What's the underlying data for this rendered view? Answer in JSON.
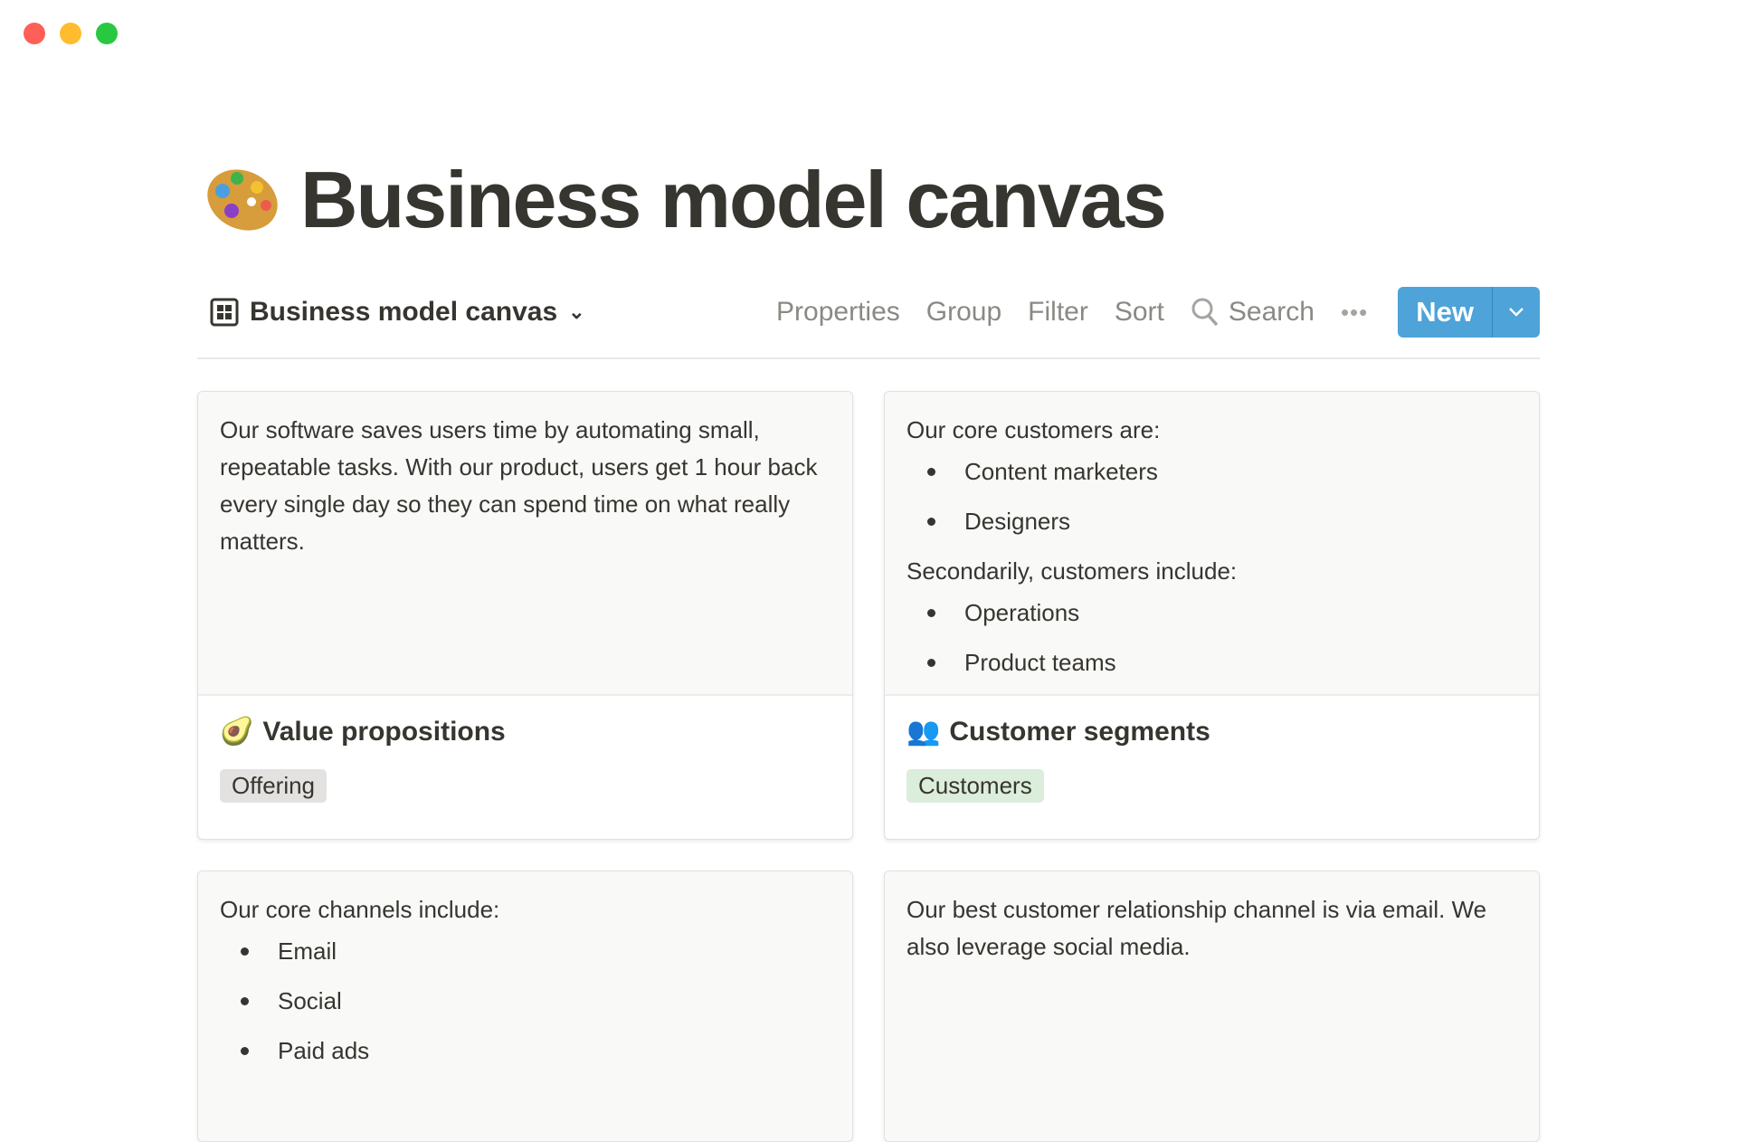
{
  "window": {
    "controls": [
      {
        "name": "close",
        "color": "#fe5f57"
      },
      {
        "name": "minimize",
        "color": "#febc2e"
      },
      {
        "name": "maximize",
        "color": "#28c840"
      }
    ]
  },
  "page": {
    "icon": "artist-palette-icon",
    "title": "Business model canvas"
  },
  "toolbar": {
    "view_name": "Business model canvas",
    "properties": "Properties",
    "group": "Group",
    "filter": "Filter",
    "sort": "Sort",
    "search": "Search",
    "new": "New",
    "accent": "#4ea3d8"
  },
  "cards": [
    {
      "paragraphs": [
        "Our software saves users time by automating small, repeatable tasks. With our product, users get 1 hour back every single day so they can spend time on what really matters."
      ],
      "icon": "avocado-icon",
      "title": "Value propositions",
      "tag": "Offering",
      "tag_color": "#e3e2e0"
    },
    {
      "intro": "Our core customers are:",
      "list1": [
        "Content marketers",
        "Designers"
      ],
      "mid": "Secondarily, customers include:",
      "list2": [
        "Operations",
        "Product teams"
      ],
      "icon": "busts-icon",
      "title": "Customer segments",
      "tag": "Customers",
      "tag_color": "#dbeddb"
    },
    {
      "intro": "Our core channels include:",
      "list1": [
        "Email",
        "Social",
        "Paid ads"
      ]
    },
    {
      "paragraphs": [
        "Our best customer relationship channel is via email. We also leverage social media."
      ]
    }
  ]
}
